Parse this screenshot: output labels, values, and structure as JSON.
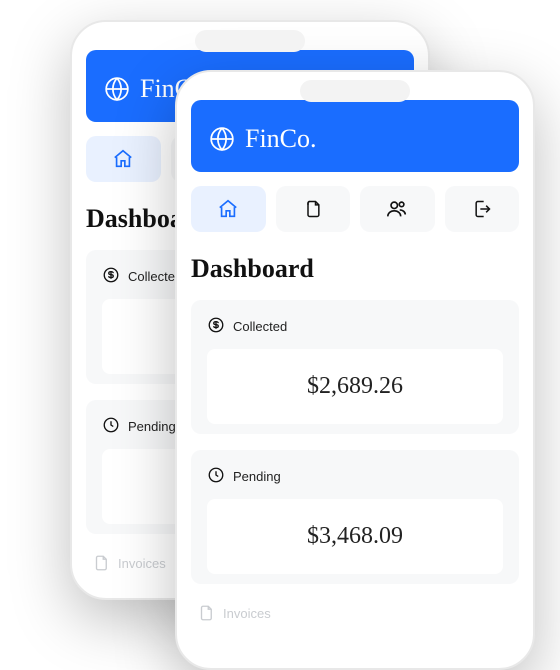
{
  "brand": "FinCo.",
  "page_title": "Dashboard",
  "nav": {
    "home": "home",
    "docs": "documents",
    "people": "people",
    "logout": "logout"
  },
  "cards": {
    "collected": {
      "label": "Collected",
      "amount": "$2,689.26"
    },
    "pending": {
      "label": "Pending",
      "amount": "$3,468.09"
    }
  },
  "invoices_label": "Invoices",
  "colors": {
    "accent": "#1a6dff"
  }
}
